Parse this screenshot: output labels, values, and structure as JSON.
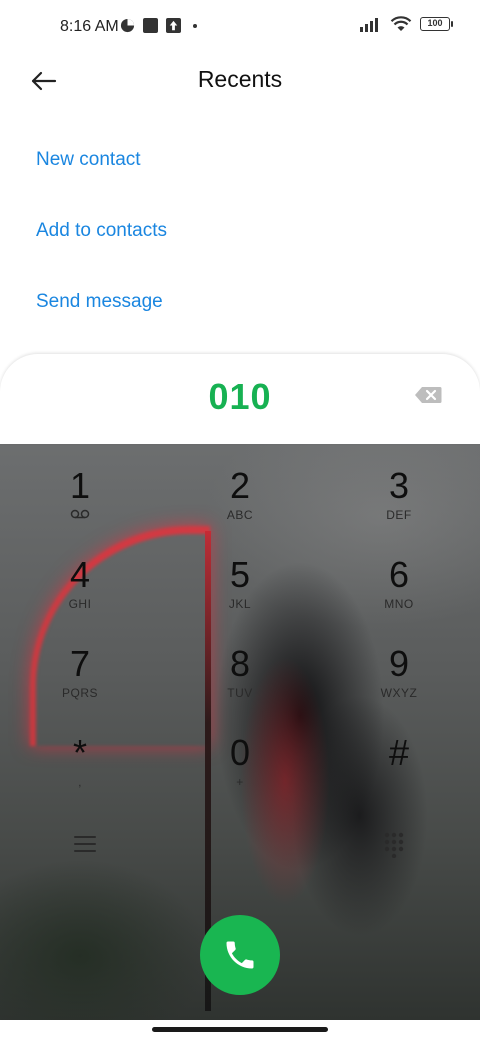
{
  "status_bar": {
    "time": "8:16 AM",
    "battery": "100",
    "icons": [
      "data-saver-icon",
      "notification-square-icon",
      "upload-icon",
      "dot-icon",
      "signal-icon",
      "wifi-icon",
      "battery-icon"
    ]
  },
  "header": {
    "title": "Recents",
    "back_icon": "arrow-left-icon"
  },
  "actions": {
    "new_contact": "New contact",
    "add_to_contacts": "Add to contacts",
    "send_message": "Send message"
  },
  "dialer": {
    "number": "010",
    "backspace_icon": "backspace-icon"
  },
  "keypad": [
    {
      "digit": "1",
      "letters": "",
      "icon": "voicemail-icon"
    },
    {
      "digit": "2",
      "letters": "ABC"
    },
    {
      "digit": "3",
      "letters": "DEF"
    },
    {
      "digit": "4",
      "letters": "GHI"
    },
    {
      "digit": "5",
      "letters": "JKL"
    },
    {
      "digit": "6",
      "letters": "MNO"
    },
    {
      "digit": "7",
      "letters": "PQRS"
    },
    {
      "digit": "8",
      "letters": "TUV"
    },
    {
      "digit": "9",
      "letters": "WXYZ"
    },
    {
      "digit": "*",
      "letters": ","
    },
    {
      "digit": "0",
      "letters": "+"
    },
    {
      "digit": "#",
      "letters": ""
    }
  ],
  "bottom_controls": {
    "menu_icon": "menu-icon",
    "dialpad_icon": "dialpad-icon",
    "call_icon": "phone-icon"
  },
  "colors": {
    "accent_link": "#1a86e0",
    "number_green": "#17b152",
    "call_green": "#19b651"
  }
}
